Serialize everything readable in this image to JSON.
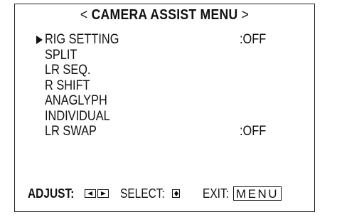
{
  "header": {
    "title_left": "<",
    "title": "CAMERA ASSIST MENU",
    "title_right": ">"
  },
  "menu": {
    "selected_index": 0,
    "items": [
      {
        "label": "RIG SETTING",
        "value": ":OFF"
      },
      {
        "label": "SPLIT",
        "value": ""
      },
      {
        "label": "LR SEQ.",
        "value": ""
      },
      {
        "label": "R SHIFT",
        "value": ""
      },
      {
        "label": "ANAGLYPH",
        "value": ""
      },
      {
        "label": "INDIVIDUAL",
        "value": ""
      },
      {
        "label": "LR SWAP",
        "value": ":OFF"
      }
    ]
  },
  "footer": {
    "adjust_label": "ADJUST:",
    "adjust_icon": "left-right-arrows-icon",
    "select_label": "SELECT:",
    "select_icon": "up-down-arrows-icon",
    "exit_label": "EXIT:",
    "exit_key": "MENU"
  }
}
